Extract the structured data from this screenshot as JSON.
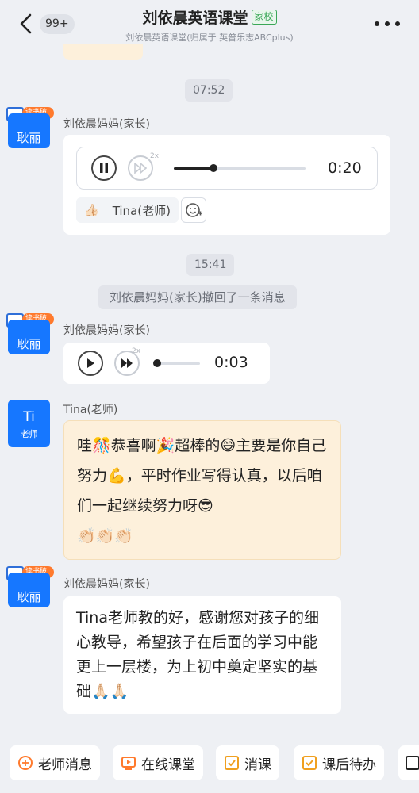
{
  "header": {
    "back_icon": "chevron-left-icon",
    "unread_count": "99+",
    "title": "刘依晨英语课堂",
    "title_tag": "家校",
    "subtitle": "刘依晨英语课堂(归属于 英普乐志ABCplus)",
    "more_icon": "more-dots-icon"
  },
  "messages": {
    "time1": "07:52",
    "time2": "15:41",
    "parent_avatar": "耿丽",
    "avatar_badge": "读书破万卷",
    "parent_name": "刘依晨妈妈(家长)",
    "teacher_avatar_initial": "Ti",
    "teacher_avatar_role": "老师",
    "teacher_name": "Tina(老师)",
    "voice1_duration": "0:20",
    "voice1_progress": 0.3,
    "voice2_duration": "0:03",
    "voice2_progress": 0.0,
    "speed_label": "2x",
    "reaction_icon": "thumbs-up-emoji",
    "reaction_name": "Tina(老师)",
    "add_reaction_icon": "add-emoji-icon",
    "recall_notice": "刘依晨妈妈(家长)撤回了一条消息",
    "teacher_msg": {
      "p1": "哇",
      "e1": "🎊",
      "p2": "恭喜啊",
      "e2": "🎉",
      "p3": "超棒的",
      "e3": "😄",
      "p4": "主要是你自己努力",
      "e4": "💪",
      "p5": "，平时作业写得认真，以后咱们一起继续努力呀",
      "e5": "😎",
      "e6": "👏🏻👏🏻👏🏻"
    },
    "parent_reply": {
      "text": "Tina老师教的好，感谢您对孩子的细心教导，希望孩子在后面的学习中能更上一层楼，为上初中奠定坚实的基础",
      "emoji": "🙏🏻🙏🏻"
    }
  },
  "toolbar": {
    "teacher_msg": "老师消息",
    "online_class": "在线课堂",
    "cancel_class": "消课",
    "homework": "课后待办"
  },
  "colors": {
    "accent": "#1677ff",
    "orange_bubble": "#fdf0db",
    "tag_green": "#3aa757",
    "icon_orange": "#ff7a2d"
  }
}
